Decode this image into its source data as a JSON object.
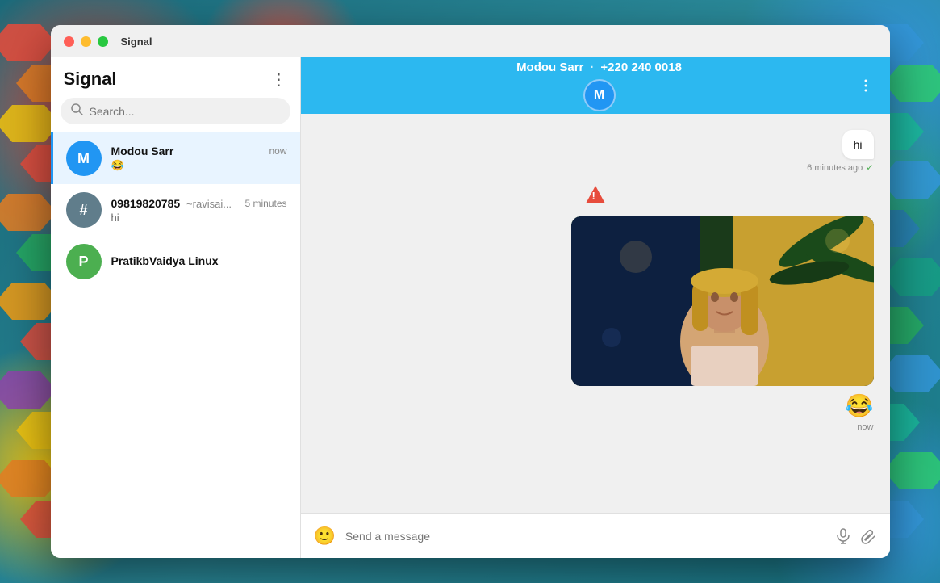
{
  "window": {
    "title": "Signal",
    "traffic_lights": [
      "close",
      "minimize",
      "maximize"
    ]
  },
  "sidebar": {
    "title": "Signal",
    "more_label": "⋮",
    "search": {
      "placeholder": "Search...",
      "value": ""
    },
    "contacts": [
      {
        "id": "modou-sarr",
        "name": "Modou Sarr",
        "avatar_letter": "M",
        "avatar_class": "avatar-m",
        "time": "now",
        "preview": "😂",
        "active": true
      },
      {
        "id": "09819820785",
        "name": "09819820785",
        "avatar_letter": "#",
        "avatar_class": "avatar-hash",
        "time": "5 minutes",
        "preview": "hi",
        "subtitle": "~ravisai...",
        "active": false
      },
      {
        "id": "pratikb-vaidya",
        "name": "PratikbVaidya Linux",
        "avatar_letter": "P",
        "avatar_class": "avatar-p",
        "time": "",
        "preview": "",
        "active": false
      }
    ]
  },
  "chat": {
    "contact_name": "Modou Sarr",
    "separator": "·",
    "phone": "+220 240 0018",
    "avatar_letter": "M",
    "messages": [
      {
        "id": "msg-hi",
        "type": "sent",
        "text": "hi",
        "time": "6 minutes ago",
        "delivered": true
      },
      {
        "id": "msg-gif",
        "type": "sent-image",
        "emoji": "😂",
        "time": "now"
      }
    ],
    "input": {
      "placeholder": "Send a message",
      "value": ""
    }
  }
}
